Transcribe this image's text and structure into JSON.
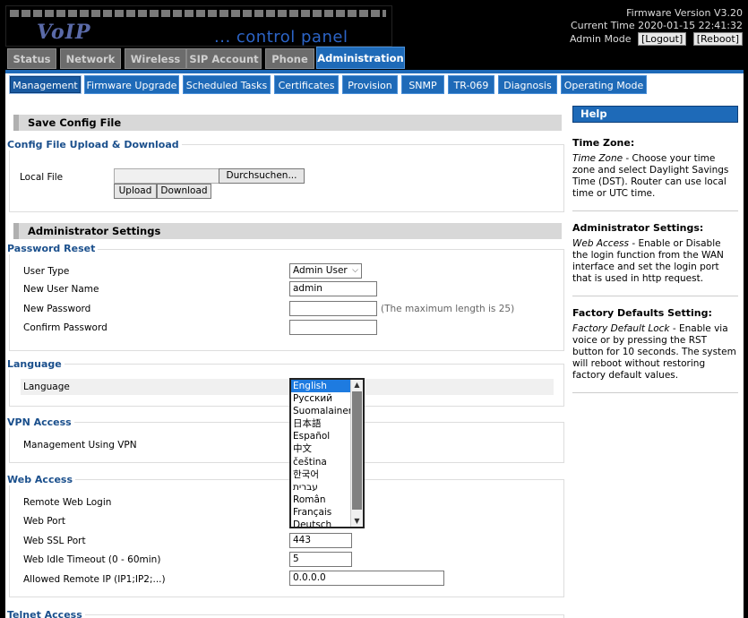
{
  "header": {
    "logo_voip": "VoIP",
    "logo_tagline": "... control panel",
    "firmware": "Firmware Version V3.20",
    "current_time": "Current Time 2020-01-15 22:41:32",
    "admin_mode": "Admin Mode",
    "logout_label": "[Logout]",
    "reboot_label": "[Reboot]"
  },
  "main_tabs": [
    {
      "label": "Status"
    },
    {
      "label": "Network"
    },
    {
      "label": "Wireless"
    },
    {
      "label": "SIP Account"
    },
    {
      "label": "Phone"
    },
    {
      "label": "Administration",
      "active": true
    }
  ],
  "sub_tabs": [
    {
      "label": "Management",
      "active": true
    },
    {
      "label": "Firmware Upgrade"
    },
    {
      "label": "Scheduled Tasks"
    },
    {
      "label": "Certificates"
    },
    {
      "label": "Provision"
    },
    {
      "label": "SNMP"
    },
    {
      "label": "TR-069"
    },
    {
      "label": "Diagnosis"
    },
    {
      "label": "Operating Mode"
    }
  ],
  "save_config": {
    "header": "Save Config File",
    "fieldset_title": "Config File Upload & Download",
    "local_file_label": "Local File",
    "browse_label": "Durchsuchen...",
    "upload_label": "Upload",
    "download_label": "Download"
  },
  "admin_settings": {
    "header": "Administrator Settings",
    "password_reset": {
      "title": "Password Reset",
      "user_type_label": "User Type",
      "user_type_value": "Admin User",
      "new_user_name_label": "New User Name",
      "new_user_name_value": "admin",
      "new_password_label": "New Password",
      "new_password_hint": "(The maximum length is 25)",
      "confirm_password_label": "Confirm Password"
    },
    "language": {
      "title": "Language",
      "label": "Language",
      "selected": "English",
      "options": [
        "English",
        "Русский",
        "Suomalainen",
        "日本語",
        "Español",
        "中文",
        "čeština",
        "한국어",
        "עברית",
        "Român",
        "Français",
        "Deutsch"
      ]
    },
    "vpn": {
      "title": "VPN Access",
      "management_label": "Management Using VPN"
    },
    "web_access": {
      "title": "Web Access",
      "remote_login_label": "Remote Web Login",
      "web_port_label": "Web Port",
      "ssl_port_label": "Web SSL Port",
      "ssl_port_value": "443",
      "idle_timeout_label": "Web Idle Timeout (0 - 60min)",
      "idle_timeout_value": "5",
      "allowed_ip_label": "Allowed Remote IP (IP1;IP2;...)",
      "allowed_ip_value": "0.0.0.0"
    },
    "telnet": {
      "title": "Telnet Access"
    }
  },
  "help": {
    "title": "Help",
    "sections": [
      {
        "heading": "Time Zone:",
        "term": "Time Zone",
        "text": " - Choose your time zone and select Daylight Savings Time (DST). Router can use local time or UTC time."
      },
      {
        "heading": "Administrator Settings:",
        "term": "Web Access",
        "text": " - Enable or Disable the login function from the WAN interface and set the login port that is used in http request."
      },
      {
        "heading": "Factory Defaults Setting:",
        "term": "Factory Default Lock",
        "text": " - Enable via voice or by pressing the RST button for 10 seconds. The system will reboot without restoring factory default values."
      }
    ]
  }
}
